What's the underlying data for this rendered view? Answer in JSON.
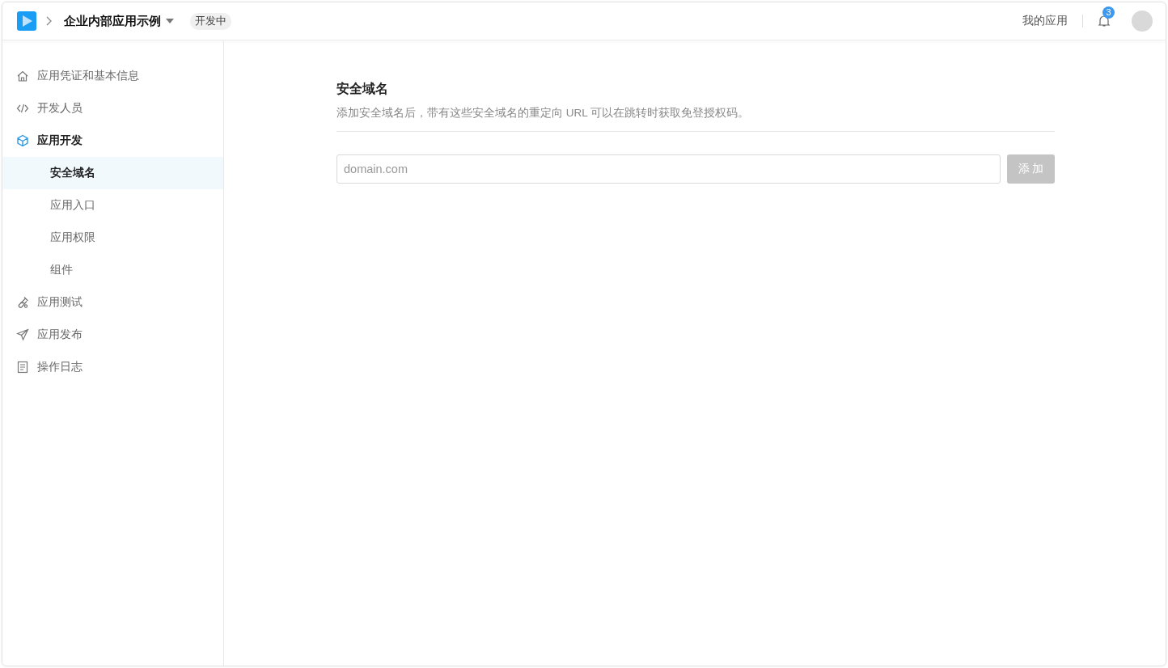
{
  "header": {
    "app_name": "企业内部应用示例",
    "status_badge": "开发中",
    "my_apps_link": "我的应用",
    "notification_count": "3"
  },
  "sidebar": {
    "items": [
      {
        "label": "应用凭证和基本信息",
        "selected": false
      },
      {
        "label": "开发人员",
        "selected": false
      },
      {
        "label": "应用开发",
        "selected": false,
        "expanded": true,
        "children": [
          {
            "label": "安全域名",
            "selected": true
          },
          {
            "label": "应用入口",
            "selected": false
          },
          {
            "label": "应用权限",
            "selected": false
          },
          {
            "label": "组件",
            "selected": false
          }
        ]
      },
      {
        "label": "应用测试",
        "selected": false
      },
      {
        "label": "应用发布",
        "selected": false
      },
      {
        "label": "操作日志",
        "selected": false
      }
    ]
  },
  "section": {
    "title": "安全域名",
    "description": "添加安全域名后，带有这些安全域名的重定向 URL 可以在跳转时获取免登授权码。",
    "domain_field": {
      "placeholder": "domain.com"
    },
    "add_button": {
      "label": "添 加",
      "disabled": true
    }
  }
}
